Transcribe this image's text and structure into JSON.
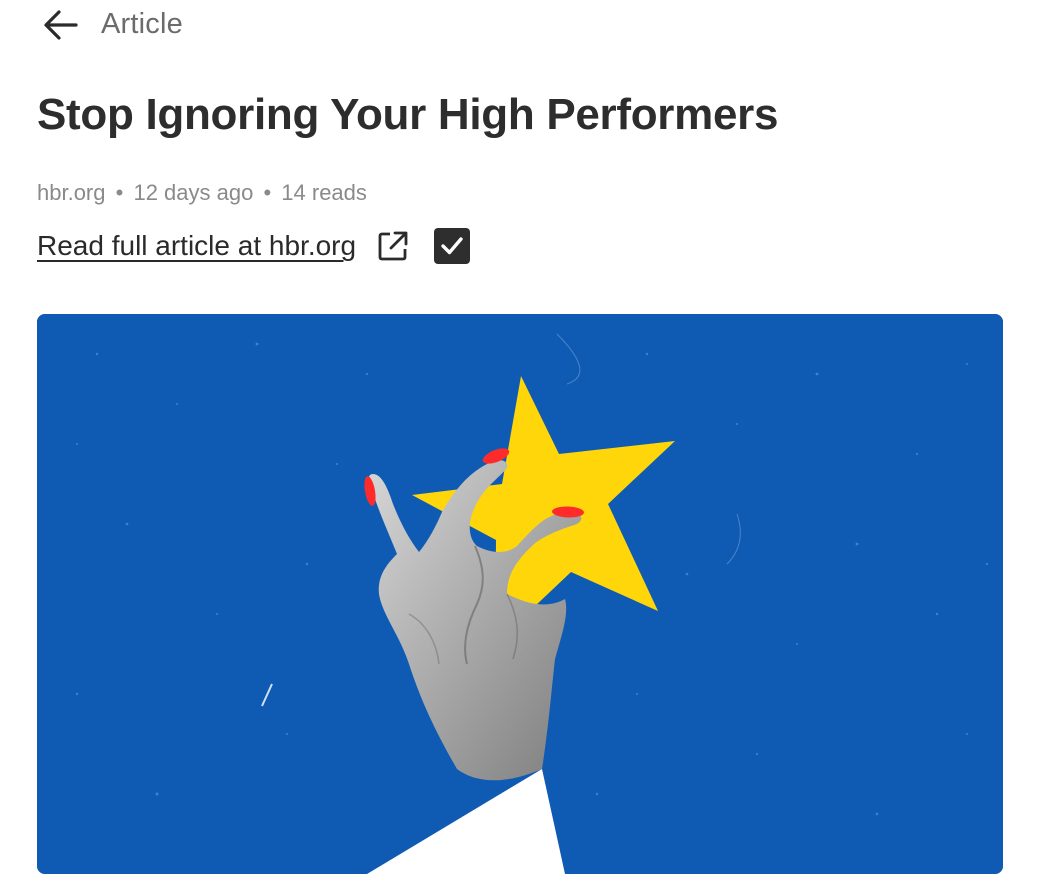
{
  "header": {
    "title": "Article",
    "back_icon": "arrow-left-icon"
  },
  "article": {
    "title": "Stop Ignoring Your High Performers",
    "meta": {
      "source": "hbr.org",
      "age": "12 days ago",
      "reads": "14 reads",
      "separator": "•"
    },
    "read_link": "Read full article at hbr.org",
    "external_icon": "external-link-icon",
    "checkbox_checked": true
  },
  "colors": {
    "hero_background": "#0f5bb4",
    "star": "#ffd60a",
    "nails": "#ff2b2b"
  }
}
